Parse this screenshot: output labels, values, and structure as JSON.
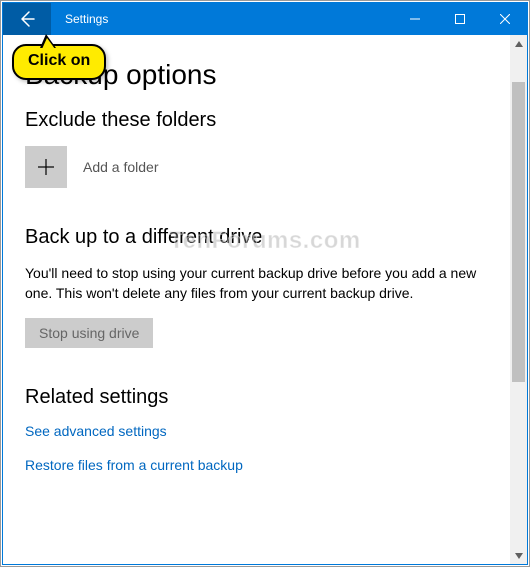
{
  "titlebar": {
    "title": "Settings"
  },
  "callout": {
    "text": "Click on"
  },
  "page": {
    "title": "Backup options"
  },
  "exclude": {
    "heading": "Exclude these folders",
    "add_label": "Add a folder"
  },
  "backup_drive": {
    "heading": "Back up to a different drive",
    "body": "You'll need to stop using your current backup drive before you add a new one. This won't delete any files from your current backup drive.",
    "button": "Stop using drive"
  },
  "related": {
    "heading": "Related settings",
    "link_advanced": "See advanced settings",
    "link_restore": "Restore files from a current backup"
  },
  "watermark": "TenForums.com"
}
